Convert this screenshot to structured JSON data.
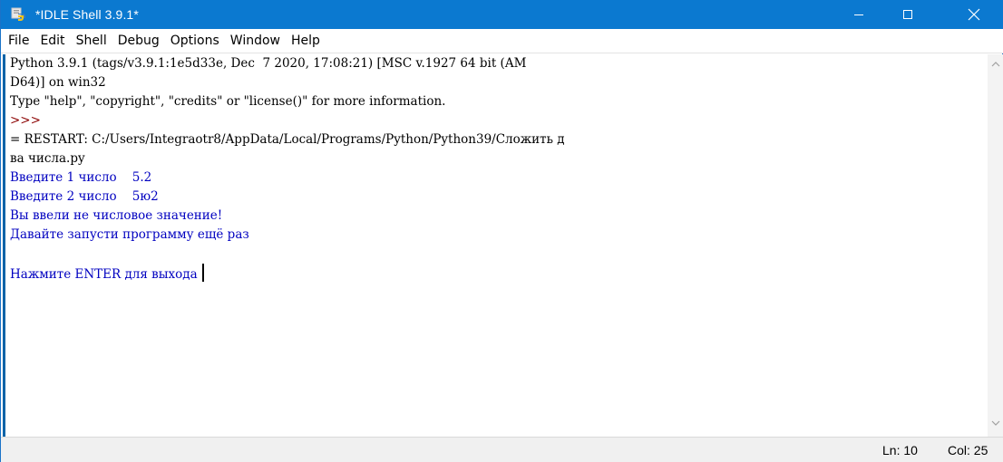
{
  "window": {
    "title": "*IDLE Shell 3.9.1*",
    "accent_color": "#0b79d0",
    "icons": {
      "app": "idle-python-icon",
      "minimize": "minimize-icon",
      "maximize": "maximize-icon",
      "close": "close-icon"
    }
  },
  "menu": {
    "items": [
      "File",
      "Edit",
      "Shell",
      "Debug",
      "Options",
      "Window",
      "Help"
    ]
  },
  "shell": {
    "lines": [
      "Python 3.9.1 (tags/v3.9.1:1e5d33e, Dec  7 2020, 17:08:21) [MSC v.1927 64 bit (AM",
      "D64)] on win32",
      "Type \"help\", \"copyright\", \"credits\" or \"license()\" for more information.",
      ">>> ",
      "= RESTART: C:/Users/Integraotr8/AppData/Local/Programs/Python/Python39/Сложить д",
      "ва числа.py",
      "Введите 1 число    5.2",
      "Введите 2 число    5ю2",
      "Вы ввели не числовое значение!",
      "Давайте запусти программу ещё раз",
      "",
      "Нажмите ENTER для выхода "
    ],
    "colors": {
      "output": "#0000c0",
      "prompt": "#8b0000",
      "text": "#000000"
    }
  },
  "status": {
    "ln": "Ln: 10",
    "col": "Col: 25"
  }
}
